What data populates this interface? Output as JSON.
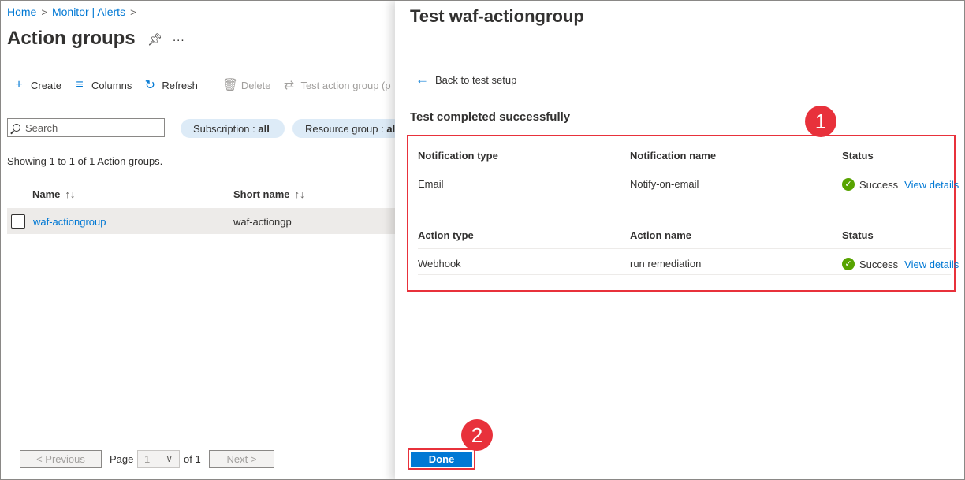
{
  "breadcrumb": {
    "items": [
      "Home",
      "Monitor | Alerts"
    ],
    "separator": ">"
  },
  "page": {
    "title": "Action groups",
    "more": "..."
  },
  "toolbar": {
    "create": "Create",
    "columns": "Columns",
    "refresh": "Refresh",
    "delete": "Delete",
    "test": "Test action group (p"
  },
  "filters": {
    "search_placeholder": "Search",
    "subscription_label": "Subscription :",
    "subscription_value": "all",
    "resource_group_label": "Resource group :",
    "resource_group_value": "al"
  },
  "list": {
    "showing": "Showing 1 to 1 of 1 Action groups.",
    "columns": {
      "name": "Name",
      "short_name": "Short name",
      "sort_glyph": "↑↓"
    },
    "rows": [
      {
        "name": "waf-actiongroup",
        "short_name": "waf-actiongp"
      }
    ]
  },
  "pagination": {
    "previous": "< Previous",
    "page_label": "Page",
    "page_value": "1",
    "of_label": "of 1",
    "next": "Next >"
  },
  "pane": {
    "title": "Test waf-actiongroup",
    "back": "Back to test setup",
    "result_heading": "Test completed successfully",
    "notifications": {
      "headers": {
        "type": "Notification type",
        "name": "Notification name",
        "status": "Status"
      },
      "rows": [
        {
          "type": "Email",
          "name": "Notify-on-email",
          "status": "Success",
          "link": "View details"
        }
      ]
    },
    "actions": {
      "headers": {
        "type": "Action type",
        "name": "Action name",
        "status": "Status"
      },
      "rows": [
        {
          "type": "Webhook",
          "name": "run remediation",
          "status": "Success",
          "link": "View details"
        }
      ]
    },
    "done": "Done"
  },
  "callouts": {
    "first": "1",
    "second": "2"
  },
  "colors": {
    "accent": "#0078d4",
    "callout": "#e8313b",
    "success": "#57a300"
  },
  "icons": {
    "create": "plus-icon",
    "columns": "columns-icon",
    "refresh": "refresh-icon",
    "delete": "trash-icon",
    "test": "test-arrows-icon",
    "pin": "pin-icon",
    "back": "arrow-left-icon",
    "status": "success-check-icon"
  }
}
